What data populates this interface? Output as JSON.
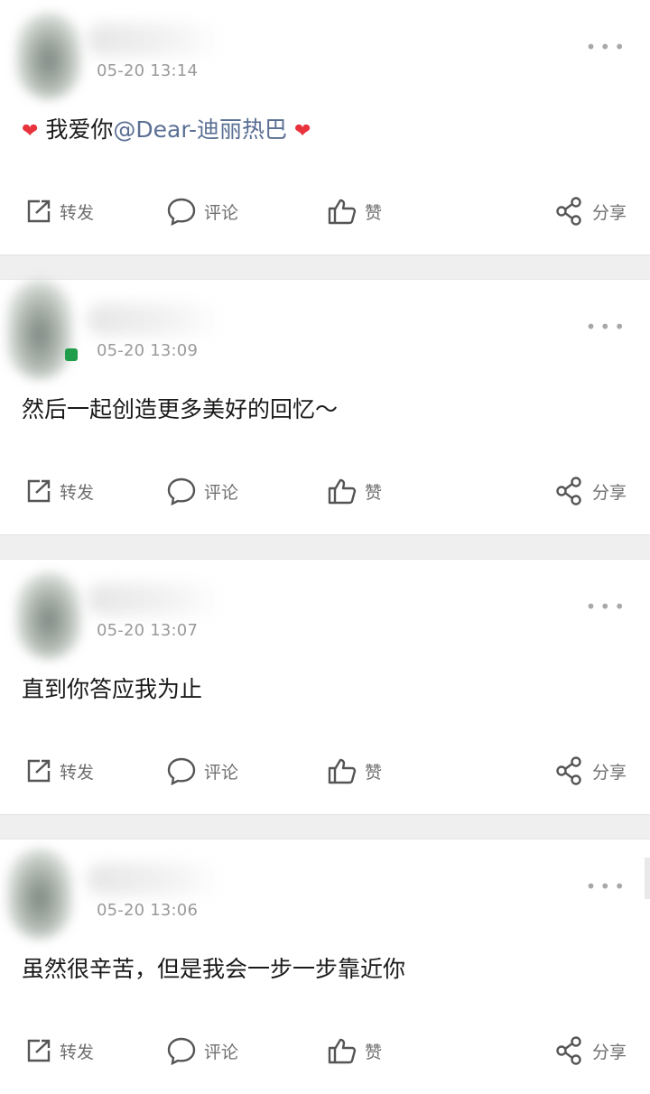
{
  "posts": [
    {
      "time": "05-20 13:14",
      "content": {
        "heart_left": "❤",
        "text": "我爱你",
        "mention": "@Dear-迪丽热巴",
        "heart_right": "❤"
      },
      "actions": {
        "repost": "转发",
        "comment": "评论",
        "like": "赞",
        "share": "分享"
      }
    },
    {
      "time": "05-20 13:09",
      "content": {
        "text": "然后一起创造更多美好的回忆～"
      },
      "actions": {
        "repost": "转发",
        "comment": "评论",
        "like": "赞",
        "share": "分享"
      }
    },
    {
      "time": "05-20 13:07",
      "content": {
        "text": "直到你答应我为止"
      },
      "actions": {
        "repost": "转发",
        "comment": "评论",
        "like": "赞",
        "share": "分享"
      }
    },
    {
      "time": "05-20 13:06",
      "content": {
        "text": "虽然很辛苦，但是我会一步一步靠近你"
      },
      "actions": {
        "repost": "转发",
        "comment": "评论",
        "like": "赞",
        "share": "分享"
      }
    }
  ],
  "more_icon": "•••",
  "colors": {
    "heart": "#e8323c",
    "mention": "#5a6f93",
    "meta": "#9a9a9a",
    "action": "#6f6f6f",
    "divider": "#efefef"
  },
  "icons": [
    "repost-icon",
    "comment-icon",
    "like-icon",
    "share-icon",
    "more-icon"
  ]
}
